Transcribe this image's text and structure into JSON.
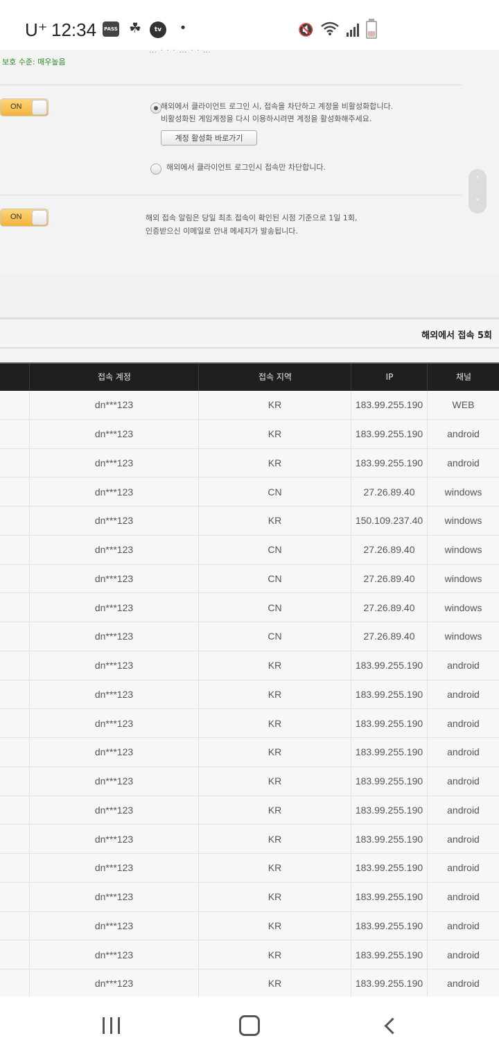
{
  "status_bar": {
    "carrier": "U⁺",
    "time": "12:34",
    "pass_icon_text": "PASS",
    "tv_icon_text": "tv",
    "dot": "•",
    "icons": [
      "pass-icon",
      "mascot-icon",
      "tv-talk-icon",
      "mute-vibrate-icon",
      "wifi-icon",
      "signal-icon",
      "battery-icon"
    ]
  },
  "settings": {
    "cut_text": "… · · · … · · …",
    "protection_level": "보호 수준: 매우높음",
    "block_toggle": {
      "label": "ON",
      "state": "on"
    },
    "option1_line1": "해외에서 클라이언트 로그인 시, 접속을 차단하고 계정을 비활성화합니다.",
    "option1_line2": "비활성화된 게임계정을 다시 이용하시려면 계정을 활성화해주세요.",
    "activate_button": "계정 활성화 바로가기",
    "option2": "해외에서 클라이언트 로그인시 접속만 차단합니다.",
    "selected_option": 1,
    "notify_toggle": {
      "label": "ON",
      "state": "on"
    },
    "notify_line1": "해외 접속 알림은 당일 최초 접속이 확인된 시점 기준으로 1일 1회,",
    "notify_line2": "인증받으신 이메일로 안내 메세지가 발송됩니다.",
    "scroll_up": "˄",
    "scroll_down": "˅"
  },
  "summary": {
    "overseas_count": "해외에서 접속 5회"
  },
  "table": {
    "headers": [
      "",
      "접속 계정",
      "접속 지역",
      "IP",
      "채널"
    ],
    "rows": [
      [
        "dn***123",
        "KR",
        "183.99.255.190",
        "WEB"
      ],
      [
        "dn***123",
        "KR",
        "183.99.255.190",
        "android"
      ],
      [
        "dn***123",
        "KR",
        "183.99.255.190",
        "android"
      ],
      [
        "dn***123",
        "CN",
        "27.26.89.40",
        "windows"
      ],
      [
        "dn***123",
        "KR",
        "150.109.237.40",
        "windows"
      ],
      [
        "dn***123",
        "CN",
        "27.26.89.40",
        "windows"
      ],
      [
        "dn***123",
        "CN",
        "27.26.89.40",
        "windows"
      ],
      [
        "dn***123",
        "CN",
        "27.26.89.40",
        "windows"
      ],
      [
        "dn***123",
        "CN",
        "27.26.89.40",
        "windows"
      ],
      [
        "dn***123",
        "KR",
        "183.99.255.190",
        "android"
      ],
      [
        "dn***123",
        "KR",
        "183.99.255.190",
        "android"
      ],
      [
        "dn***123",
        "KR",
        "183.99.255.190",
        "android"
      ],
      [
        "dn***123",
        "KR",
        "183.99.255.190",
        "android"
      ],
      [
        "dn***123",
        "KR",
        "183.99.255.190",
        "android"
      ],
      [
        "dn***123",
        "KR",
        "183.99.255.190",
        "android"
      ],
      [
        "dn***123",
        "KR",
        "183.99.255.190",
        "android"
      ],
      [
        "dn***123",
        "KR",
        "183.99.255.190",
        "android"
      ],
      [
        "dn***123",
        "KR",
        "183.99.255.190",
        "android"
      ],
      [
        "dn***123",
        "KR",
        "183.99.255.190",
        "android"
      ],
      [
        "dn***123",
        "KR",
        "183.99.255.190",
        "android"
      ],
      [
        "dn***123",
        "KR",
        "183.99.255.190",
        "android"
      ]
    ]
  },
  "nav_bar": {
    "icons": [
      "recent-apps-icon",
      "home-icon",
      "back-icon"
    ]
  },
  "colors": {
    "toggle_on": "#f2b43a",
    "protection_green": "#2b8a2b",
    "table_header_bg": "#1f1f1f"
  }
}
